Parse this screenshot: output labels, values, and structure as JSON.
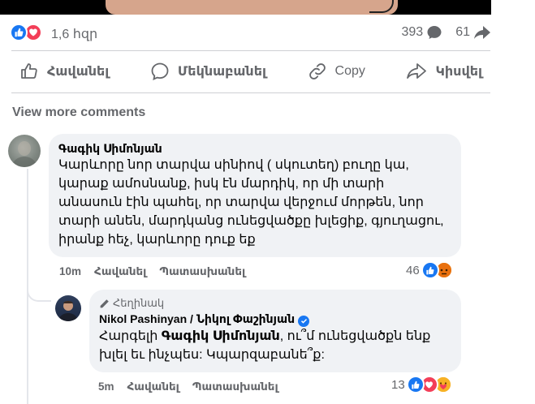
{
  "post_stats": {
    "reactions_count": "1,6 հզր",
    "comments_count": "393",
    "shares_count": "61"
  },
  "actions": {
    "like": "Հավանել",
    "comment": "Մեկնաբանել",
    "copy": "Copy",
    "share": "Կիսվել"
  },
  "view_more": "View more comments",
  "comments": [
    {
      "author": "Գագիկ Սիմոնյան",
      "text": "Կարևորը նոր տարվա սինիով ( սկուտեղ) բուղը կա, կարաք ամոսնանք, իսկ էն մարդիկ, որ մի տարի անասուն էին պահել, որ տարվա վերջում մորթեն, նոր տարի անեն, մարդկանց ունեցվածքը խլեցիք, գյուղացու, իրանք հեչ, կարևորը դուք եք",
      "time": "10m",
      "like": "Հավանել",
      "reply": "Պատասխանել",
      "reaction_count": "46"
    }
  ],
  "reply": {
    "badge": "Հեղինակ",
    "author": "Nikol Pashinyan / Նիկոլ Փաշինյան",
    "text_prefix": "Հարգելի ",
    "mention": "Գագիկ Սիմոնյան",
    "text_suffix": ", ու՞մ ունեցվածքն ենք խլել եւ ինչպես: Կպարզաբանե՞ք:",
    "time": "5m",
    "like": "Հավանել",
    "reply": "Պատասխանել",
    "reaction_count": "13"
  },
  "colors": {
    "accent": "#1877f2",
    "love": "#f33e58",
    "secondary_text": "#65676b",
    "bubble": "#f0f2f5"
  }
}
